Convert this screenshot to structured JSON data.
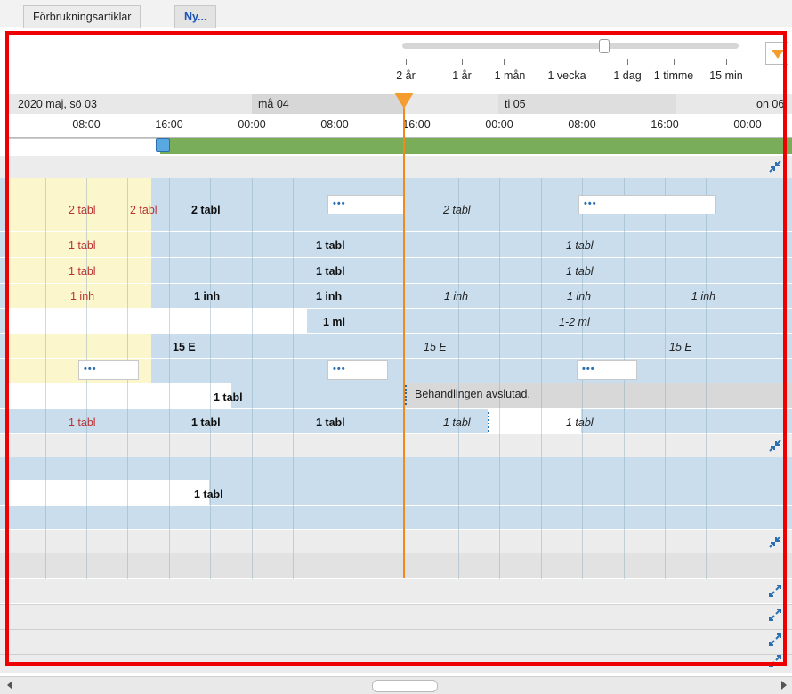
{
  "tabs": [
    {
      "label": "Förbrukningsartiklar"
    },
    {
      "label": "Ny..."
    }
  ],
  "zoom": {
    "levels": [
      "2 år",
      "1 år",
      "1 mån",
      "1 vecka",
      "1 dag",
      "1 timme",
      "15 min"
    ]
  },
  "dates": {
    "d1": "2020 maj, sö 03",
    "d2": "må 04",
    "d3": "ti 05",
    "d4": "on 06"
  },
  "hours": [
    "08:00",
    "16:00",
    "00:00",
    "08:00",
    "16:00",
    "00:00",
    "08:00",
    "16:00",
    "00:00"
  ],
  "cells": {
    "r1a": "2 tabl",
    "r1b": "2 tabl",
    "r1c": "2 tabl",
    "r1d": "2 tabl",
    "r2a": "1 tabl",
    "r2b": "1 tabl",
    "r2c": "1 tabl",
    "r3a": "1 tabl",
    "r3b": "1 tabl",
    "r3c": "1 tabl",
    "r4a": "1 inh",
    "r4b": "1 inh",
    "r4c": "1 inh",
    "r4d": "1 inh",
    "r4e": "1 inh",
    "r4f": "1 inh",
    "r5a": "1 ml",
    "r5b": "1-2 ml",
    "r6a": "15 E",
    "r6b": "15 E",
    "r6c": "15 E",
    "r8a": "1 tabl",
    "r8b": "Behandlingen avslutad.",
    "r9a": "1 tabl",
    "r9b": "1 tabl",
    "r9c": "1 tabl",
    "r9d": "1 tabl",
    "r9e": "1 tabl",
    "r11a": "1 tabl"
  },
  "dots": "•••",
  "colors": {
    "accent": "#f59c2f",
    "now_line": "#f08a1a",
    "row_blue": "#c9dded",
    "row_yellow": "#fbf6cc",
    "header_green": "#79ad5a",
    "red_text": "#b83232",
    "highlight_box": "#ee0000"
  }
}
